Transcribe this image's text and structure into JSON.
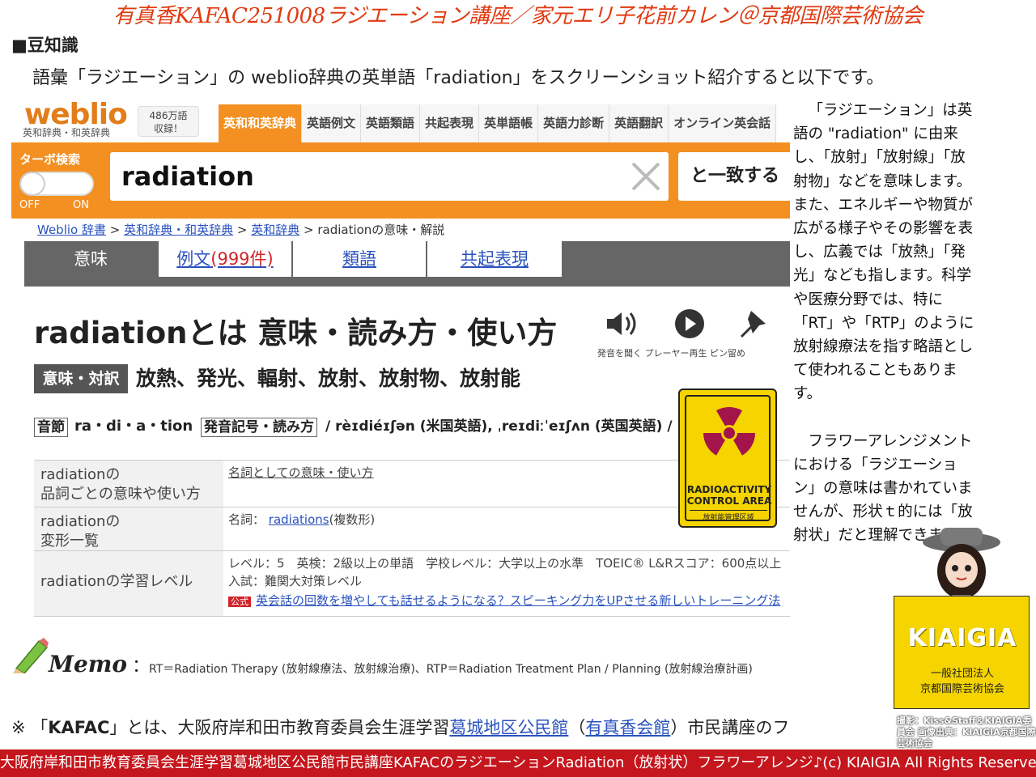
{
  "page_title": "有真香KAFAC251008ラジエーション講座／家元エリ子花前カレン＠京都国際芸術協会",
  "trivia_heading": "■豆知識",
  "intro": "語彙「ラジエーション」の weblio辞典の英単語「radiation」をスクリーンショット紹介すると以下です。",
  "weblio": {
    "logo": "weblio",
    "logo_sub": "英和辞典・和英辞典",
    "count_1": "486万語",
    "count_2": "収録！",
    "tabs": [
      "英和和英辞典",
      "英語例文",
      "英語類語",
      "共起表現",
      "英単語帳",
      "英語力診断",
      "英語翻訳",
      "オンライン英会話"
    ],
    "turbo": "ターボ検索",
    "off": "OFF",
    "on": "ON",
    "search_value": "radiation",
    "match_button": "と一致する",
    "breadcrumb": {
      "a": "Weblio 辞書",
      "sep": " > ",
      "b": "英和辞典・和英辞典",
      "c": "英和辞典",
      "d": " > radiationの意味・解説"
    },
    "subtabs": {
      "meaning": "意味",
      "examples": "例文",
      "examples_count": "(999件)",
      "synonyms": "類語",
      "collocations": "共起表現"
    },
    "heading": "radiationとは 意味・読み方・使い方",
    "icon_label": "発音を聞く プレーヤー再生 ピン留め",
    "meaning_tag": "意味・対訳",
    "meanings": "放熱、発光、輻射、放射、放射物、放射能",
    "syllable_tag": "音節",
    "syllables": "ra・di・a・tion",
    "pron_tag": "発音記号・読み方",
    "pronunciation": "/ rèɪdiéɪʃən (米国英語), ˌreɪdiːˈeɪʃʌn (英国英語) /",
    "table": [
      {
        "head": "radiationの\n品詞ごとの意味や使い方",
        "value": "名詞としての意味・使い方"
      },
      {
        "head": "radiationの\n変形一覧",
        "value_prefix": "名詞： ",
        "value_link": "radiations",
        "value_suffix": "(複数形)"
      },
      {
        "head": "radiationの学習レベル",
        "value_1": "レベル：5　英検：2級以上の単語　学校レベル：大学以上の水準　TOEIC® L&Rスコア：600点以上",
        "value_2": "入試：難関大対策レベル",
        "promo_badge": "公式",
        "promo": "英会話の回数を増やしても話せるようになる？スピーキング力をUPさせる新しいトレーニング法"
      }
    ],
    "sign_1": "RADIOACTIVITY CONTROL AREA",
    "sign_2": "放射能管理区域"
  },
  "side_text": {
    "p1": "「ラジエーション」は英語の \"radiation\" に由来し、「放射」「放射線」「放射物」などを意味します。また、エネルギーや物質が広がる様子やその影響を表し、広義では「放熱」「発光」なども指します。科学や医療分野では、特に「RT」や「RTP」のように放射線療法を指す略語として使われることもあります。",
    "p2": "フラワーアレンジメントにおける「ラジエーション」の意味は書かれていませんが、形状ｔ的には「放射状」だと理解できます。"
  },
  "memo_label": "Memo",
  "memo_colon": "：",
  "memo_text": "RT＝Radiation Therapy (放射線療法、放射線治療)、RTP＝Radiation Treatment Plan / Planning (放射線治療計画)",
  "note": {
    "prefix": "※ 「",
    "bold": "KAFAC",
    "mid": "」とは、大阪府岸和田市教育委員会生涯学習",
    "link1": "葛城地区公民館",
    "paren_open": "（",
    "link2": "有真香会館",
    "tail": "）市民講座のフ"
  },
  "kiaigia": {
    "title": "KIAIGIA",
    "line1": "一般社団法人",
    "line2": "京都国際芸術協会"
  },
  "credit": "撮影：Kiss&Staff＆KIAIGIA委員会 画像出典：KIAIGIA京都国際芸術協会",
  "footer": "大阪府岸和田市教育委員会生涯学習葛城地区公民館市民講座KAFACのラジエーションRadiation（放射状）フラワーアレンジ♪(c) KIAIGIA All Rights Reserved.",
  "colors": {
    "title": "#e03a10",
    "weblio_orange": "#f39021",
    "footer": "#c4161c",
    "kiaigia": "#f5d400"
  }
}
